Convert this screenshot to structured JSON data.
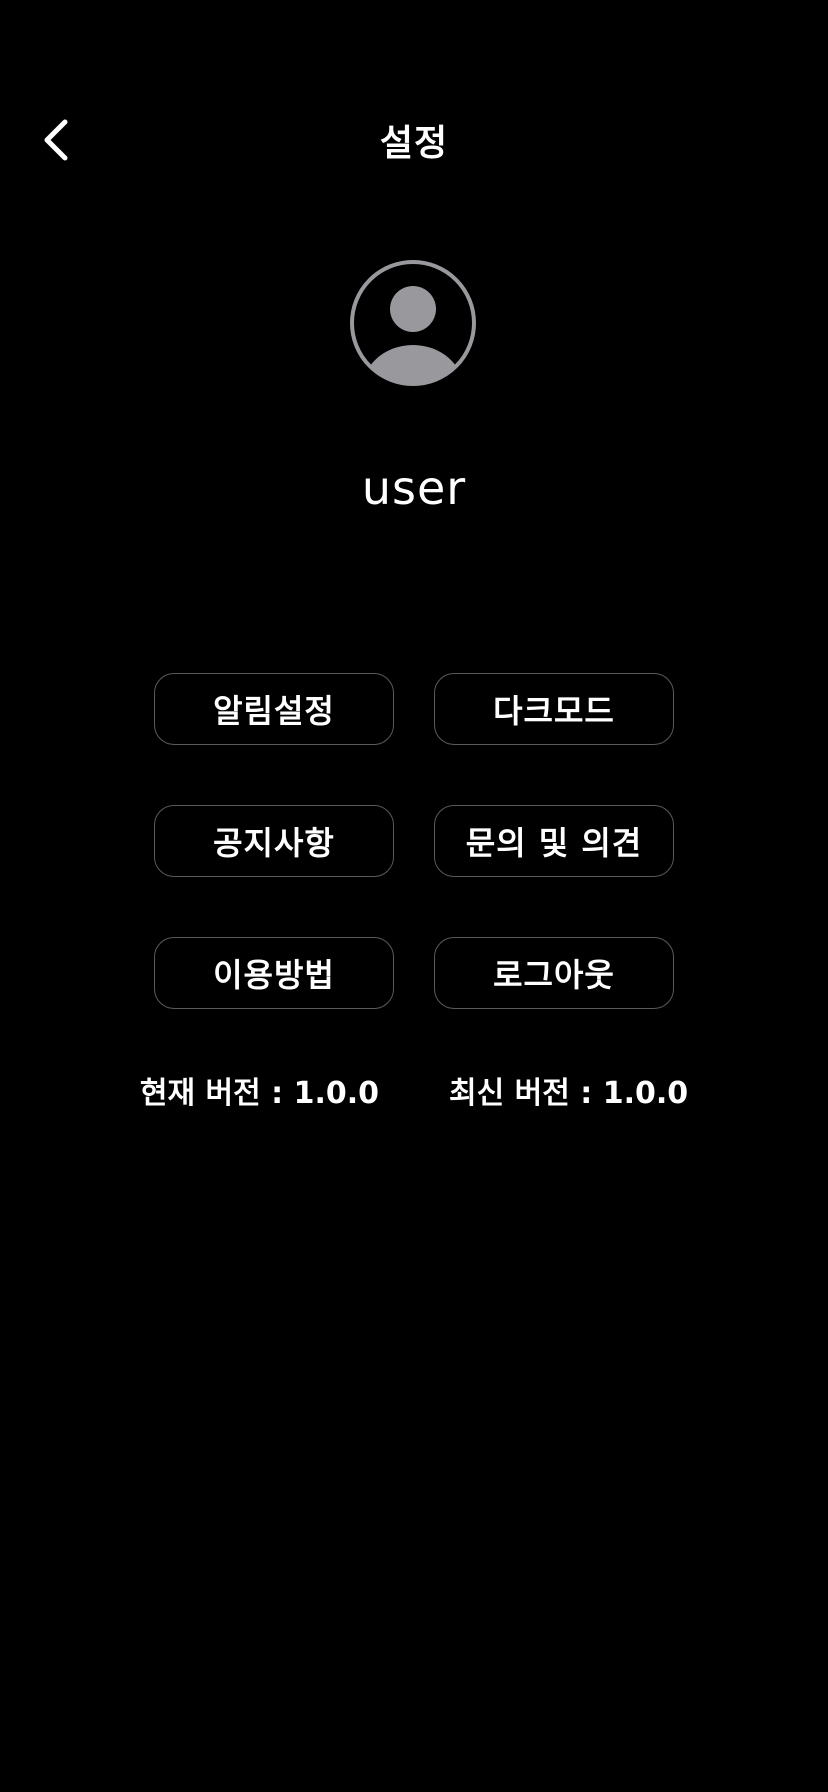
{
  "header": {
    "title": "설정",
    "back_icon": "chevron-left-icon"
  },
  "profile": {
    "avatar_icon": "user-avatar-icon",
    "username": "user"
  },
  "menu": {
    "items": [
      {
        "label": "알림설정"
      },
      {
        "label": "다크모드"
      },
      {
        "label": "공지사항"
      },
      {
        "label": "문의 및 의견"
      },
      {
        "label": "이용방법"
      },
      {
        "label": "로그아웃"
      }
    ]
  },
  "version": {
    "current": "현재 버전 : 1.0.0",
    "latest": "최신 버전 : 1.0.0"
  },
  "colors": {
    "background": "#000000",
    "text": "#ffffff",
    "avatar_gray": "#99989d",
    "button_border": "#5a5a5a"
  }
}
